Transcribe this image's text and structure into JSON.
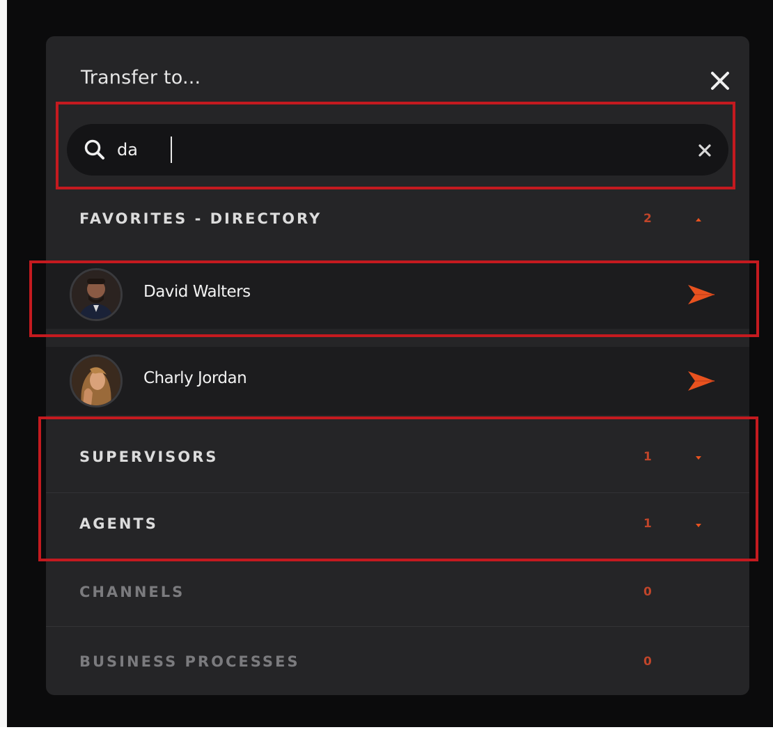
{
  "dialog": {
    "title": "Transfer to..."
  },
  "search": {
    "value": "da",
    "placeholder": ""
  },
  "sections": [
    {
      "label": "FAVORITES - DIRECTORY",
      "count": "2",
      "expanded": true
    },
    {
      "label": "SUPERVISORS",
      "count": "1",
      "expanded": false
    },
    {
      "label": "AGENTS",
      "count": "1",
      "expanded": false
    },
    {
      "label": "CHANNELS",
      "count": "0",
      "expanded": false
    },
    {
      "label": "BUSINESS PROCESSES",
      "count": "0",
      "expanded": false
    }
  ],
  "contacts": [
    {
      "name": "David Walters"
    },
    {
      "name": "Charly Jordan"
    }
  ],
  "colors": {
    "accent": "#e8521f",
    "count": "#c0452a",
    "highlight": "#c41a1f",
    "panel": "#252527"
  },
  "icons": {
    "close": "close-icon",
    "search": "search-icon",
    "clear": "clear-icon",
    "send": "send-icon",
    "chevron_up": "chevron-up-icon",
    "chevron_down": "chevron-down-icon"
  }
}
